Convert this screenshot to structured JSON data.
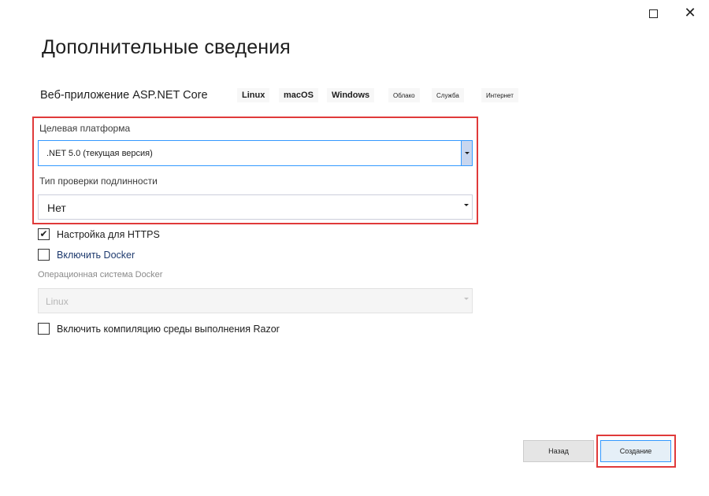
{
  "window": {
    "maximize_icon": "maximize-icon",
    "close_icon": "close-icon",
    "close_glyph": "✕"
  },
  "page": {
    "title": "Дополнительные сведения"
  },
  "project": {
    "name": "Веб-приложение ASP.NET Core",
    "tags": [
      "Linux",
      "macOS",
      "Windows",
      "Облако",
      "Служба",
      "Интернет"
    ]
  },
  "fields": {
    "framework": {
      "label": "Целевая платформа",
      "value": ".NET 5.0 (текущая версия)"
    },
    "auth": {
      "label": "Тип проверки подлинности",
      "value": "Нет"
    },
    "https": {
      "label": "Настройка для HTTPS",
      "checked": true
    },
    "docker": {
      "label": "Включить Docker",
      "checked": false
    },
    "docker_os": {
      "label": "Операционная система Docker",
      "value": "Linux",
      "disabled": true
    },
    "razor": {
      "label": "Включить компиляцию среды выполнения Razor",
      "checked": false
    }
  },
  "buttons": {
    "back": "Назад",
    "create": "Создание"
  },
  "colors": {
    "highlight": "#e03a3a",
    "focus": "#3399ff"
  }
}
